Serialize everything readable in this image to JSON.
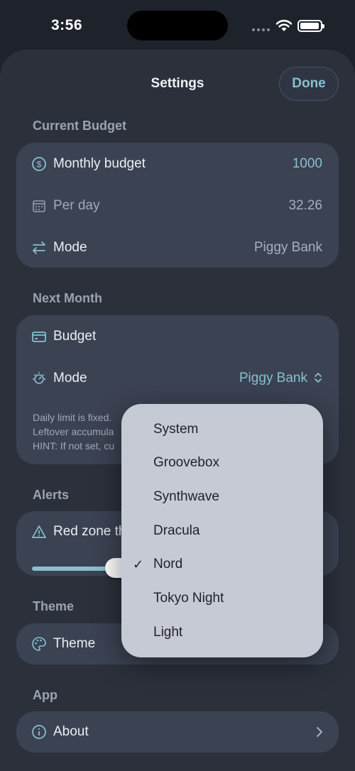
{
  "status": {
    "time": "3:56"
  },
  "header": {
    "title": "Settings",
    "done_label": "Done"
  },
  "current_budget": {
    "section_label": "Current Budget",
    "monthly_label": "Monthly budget",
    "monthly_value": "1000",
    "perday_label": "Per day",
    "perday_value": "32.26",
    "mode_label": "Mode",
    "mode_value": "Piggy Bank"
  },
  "next_month": {
    "section_label": "Next Month",
    "budget_label": "Budget",
    "mode_label": "Mode",
    "mode_value": "Piggy Bank",
    "hint_line1": "Daily limit is fixed.",
    "hint_line2": "Leftover accumula",
    "hint_line3": "HINT: If not set, cu"
  },
  "alerts": {
    "section_label": "Alerts",
    "red_zone_label": "Red zone th",
    "slider_fraction": 0.25
  },
  "theme": {
    "section_label": "Theme",
    "theme_label": "Theme"
  },
  "app": {
    "section_label": "App",
    "about_label": "About"
  },
  "theme_menu": {
    "check_mark": "✓",
    "selected": "Nord",
    "items": [
      "System",
      "Groovebox",
      "Synthwave",
      "Dracula",
      "Nord",
      "Tokyo Night",
      "Light"
    ]
  },
  "colors": {
    "accent": "#88c0d0",
    "background": "#2b303b",
    "card": "#3b4252",
    "menu": "#c6cad5"
  }
}
